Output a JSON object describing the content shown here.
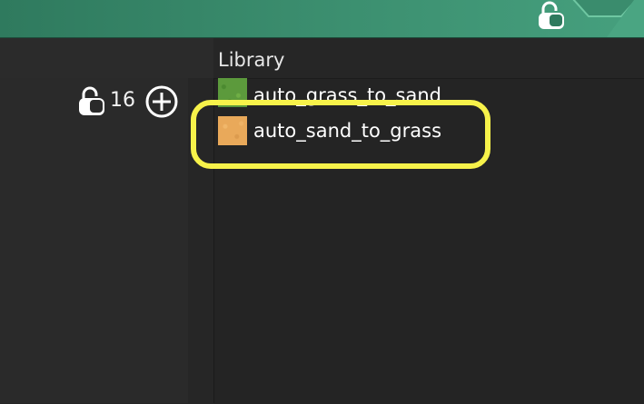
{
  "top_bar": {
    "accent": "#3a8c6d",
    "lock_icon": "lock-icon",
    "chevron_icon": "chevron-down-icon"
  },
  "left_panel": {
    "lock_icon": "lock-icon",
    "count": "16",
    "add_icon": "plus-circle-icon"
  },
  "library": {
    "title": "Library",
    "items": [
      {
        "label": "auto_grass_to_sand",
        "thumb_color": "#5c9a3c"
      },
      {
        "label": "auto_sand_to_grass",
        "thumb_color": "#e9a95a"
      }
    ]
  },
  "highlight_color": "#f7f24a"
}
